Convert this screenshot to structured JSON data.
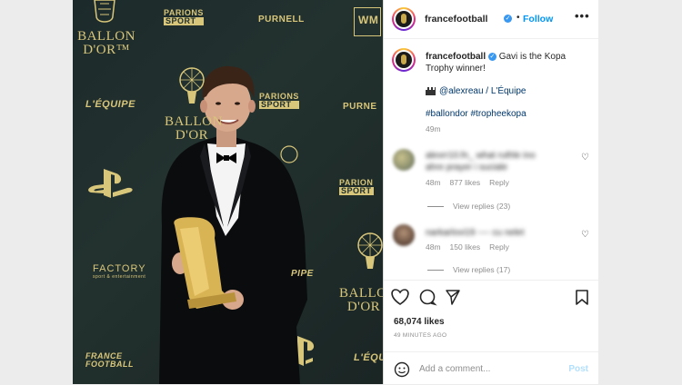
{
  "header": {
    "username": "francefootball",
    "follow_label": "Follow",
    "separator": "•",
    "more": "•••"
  },
  "caption": {
    "username": "francefootball",
    "text": "Gavi is the Kopa Trophy winner!",
    "credit": "@alexreau / L'Équipe",
    "hashtags": "#ballondor #tropheekopa",
    "time": "49m"
  },
  "comments": [
    {
      "blurred_text": "alexrr10.fn_ what ruthle ino",
      "blurred_text2": "ahre prayer i suciale",
      "time": "48m",
      "likes": "877 likes",
      "reply": "Reply",
      "view_replies": "View replies (23)"
    },
    {
      "blurred_text": "narkarlovi19 ---- cu nelet",
      "time": "48m",
      "likes": "150 likes",
      "reply": "Reply",
      "view_replies": "View replies (17)"
    }
  ],
  "post_stats": {
    "likes": "68,074 likes",
    "ago": "49 MINUTES AGO"
  },
  "comment_box": {
    "placeholder": "Add a comment...",
    "post_label": "Post"
  },
  "photo_logos": {
    "ballon1": "BALLON",
    "dor1": "D'OR™",
    "parions": "PARIONS",
    "sport": "SPORT",
    "purnell": "PURNELL",
    "wm": "WM",
    "lequipe": "L'ÉQUIPE",
    "lequipe2": "L'ÉQU",
    "ballon2": "BALLON",
    "dor2": "D'OR",
    "purnell2": "PURNE",
    "parions2": "PARIONS",
    "sport2": "SPORT",
    "parions3": "PARION",
    "sport3": "SPORT",
    "factory": "FACTORY",
    "factory_sub": "sport & entertainment",
    "ballon3": "BALLON",
    "dor3": "D'OR",
    "pipe": "PIPE",
    "france": "FRANCE",
    "football": "FOOTBALL"
  },
  "colors": {
    "accent": "#0095f6",
    "gold": "#d8c67a",
    "photo_bg": "#1f2d2c"
  },
  "icons": [
    "heart-icon",
    "comment-icon",
    "share-icon",
    "bookmark-icon",
    "emoji-icon"
  ]
}
